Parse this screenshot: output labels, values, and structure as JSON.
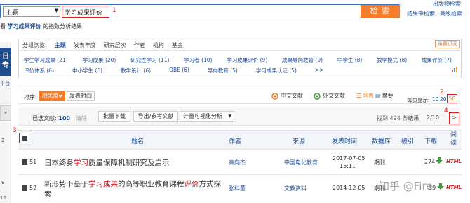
{
  "search": {
    "field_select": "主题",
    "query": "学习成果评价",
    "button_label": "检 索",
    "annotation": "1"
  },
  "top_links": {
    "publication_search": "出版物检索",
    "search_in_results": "结果中检索",
    "advanced_search": "高级检索"
  },
  "index_line": {
    "prefix": "看",
    "term": "学习成果评价",
    "suffix": "的指数分析结果"
  },
  "left_sidebar": {
    "badge_letters": "日\n专",
    "label": "平台",
    "nums": [
      "2",
      "8",
      "16"
    ]
  },
  "group_browse": {
    "label": "分组浏览:",
    "tabs": [
      "主题",
      "发表年度",
      "研究层次",
      "作者",
      "机构",
      "基金"
    ],
    "active_tab": "主题",
    "free_subscribe": "免费订阅",
    "topics_row1": [
      "学生学习成果 (21)",
      "学习成果 (20)",
      "研究性学习 (11)",
      "学习者 (10)",
      "学习成果评价 (9)",
      "成果导向教育 (9)",
      "中学生 (8)",
      "教学模式 (8)",
      "成果评价 (7)"
    ],
    "topics_row2": [
      "评价体系 (6)",
      "中小学生 (6)",
      "教学设计 (6)",
      "OBE (6)",
      "导向教育 (5)",
      "学习成果认证 (5)",
      ">>"
    ]
  },
  "sort_bar": {
    "label": "排序:",
    "relevance": "相关度",
    "publish_time": "发表时间",
    "chinese_docs": "中文文献",
    "foreign_docs": "外文文献",
    "list_view": "列表",
    "abstract_view": "摘要",
    "per_page_label": "每页显示:",
    "per_page_options": [
      "10",
      "20",
      "50"
    ],
    "per_page_selected": "50",
    "annotation": "2"
  },
  "action_bar": {
    "selected_label": "已选文献:",
    "selected_count": "100",
    "clear": "清除",
    "batch_download": "批量下载",
    "export": "导出/参考文献",
    "visualize": "计量可视化分析",
    "found_text": "找到 494 条结果",
    "page_indicator": "2/10",
    "next_symbol": ">",
    "annotation": "4"
  },
  "table": {
    "annotation": "3",
    "headers": [
      "题名",
      "作者",
      "来源",
      "发表时间",
      "数据库",
      "被引",
      "下载",
      "阅读"
    ],
    "rows": [
      {
        "num": "51",
        "title_parts": [
          "日本终身",
          "学习",
          "质量保障机制研究及启示"
        ],
        "author": "高向杰",
        "source": "中国电化教育",
        "date": "2017-07-05",
        "time": "15:11",
        "db": "期刊",
        "cited": "",
        "downloads": "274",
        "read": "HTML"
      },
      {
        "num": "52",
        "title_parts": [
          "新形势下基于",
          "学习成果",
          "的高等职业教育课程",
          "评价",
          "方式探",
          "索"
        ],
        "author": "张科董",
        "source": "文教资料",
        "date": "2014-12-05",
        "time": "",
        "db": "期刊",
        "cited": "",
        "downloads": "39",
        "read": "HTML"
      }
    ]
  },
  "watermark": "知乎 @Fire",
  "colors": {
    "accent_orange": "#f37d2a",
    "link_blue": "#1f4f99",
    "highlight_red": "#c0111c",
    "annotation_red": "#e02020"
  }
}
